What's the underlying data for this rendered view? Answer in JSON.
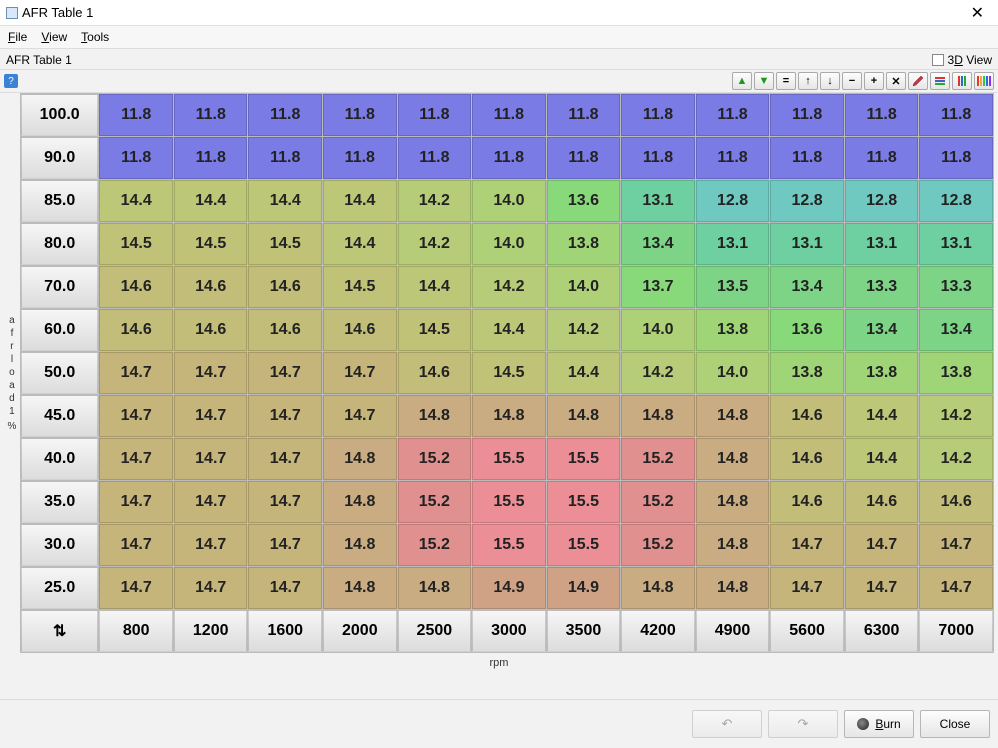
{
  "window": {
    "title": "AFR Table 1"
  },
  "menu": {
    "file": "File",
    "view": "View",
    "tools": "Tools"
  },
  "subheader": {
    "label": "AFR Table 1",
    "view3d": "3D View"
  },
  "toolbar_titles": {
    "up_green": "",
    "down_green": "",
    "eq": "=",
    "up": "↑",
    "down": "↓",
    "minus": "−",
    "plus": "+",
    "mul": "✕",
    "pencil": "",
    "hstripes": "",
    "vstripes": "",
    "colorbar": ""
  },
  "axis": {
    "y_chars": [
      "a",
      "f",
      "r",
      "l",
      "o",
      "a",
      "d",
      "1",
      "",
      "%"
    ],
    "x_label": "rpm"
  },
  "footer": {
    "burn": "Burn",
    "close": "Close"
  },
  "chart_data": {
    "type": "table",
    "title": "AFR Table 1",
    "xlabel": "rpm",
    "ylabel": "afrload1 %",
    "columns": [
      800,
      1200,
      1600,
      2000,
      2500,
      3000,
      3500,
      4200,
      4900,
      5600,
      6300,
      7000
    ],
    "row_headers": [
      100.0,
      90.0,
      85.0,
      80.0,
      70.0,
      60.0,
      50.0,
      45.0,
      40.0,
      35.0,
      30.0,
      25.0
    ],
    "rows": [
      [
        11.8,
        11.8,
        11.8,
        11.8,
        11.8,
        11.8,
        11.8,
        11.8,
        11.8,
        11.8,
        11.8,
        11.8
      ],
      [
        11.8,
        11.8,
        11.8,
        11.8,
        11.8,
        11.8,
        11.8,
        11.8,
        11.8,
        11.8,
        11.8,
        11.8
      ],
      [
        14.4,
        14.4,
        14.4,
        14.4,
        14.2,
        14.0,
        13.6,
        13.1,
        12.8,
        12.8,
        12.8,
        12.8
      ],
      [
        14.5,
        14.5,
        14.5,
        14.4,
        14.2,
        14.0,
        13.8,
        13.4,
        13.1,
        13.1,
        13.1,
        13.1
      ],
      [
        14.6,
        14.6,
        14.6,
        14.5,
        14.4,
        14.2,
        14.0,
        13.7,
        13.5,
        13.4,
        13.3,
        13.3
      ],
      [
        14.6,
        14.6,
        14.6,
        14.6,
        14.5,
        14.4,
        14.2,
        14.0,
        13.8,
        13.6,
        13.4,
        13.4
      ],
      [
        14.7,
        14.7,
        14.7,
        14.7,
        14.6,
        14.5,
        14.4,
        14.2,
        14.0,
        13.8,
        13.8,
        13.8
      ],
      [
        14.7,
        14.7,
        14.7,
        14.7,
        14.8,
        14.8,
        14.8,
        14.8,
        14.8,
        14.6,
        14.4,
        14.2
      ],
      [
        14.7,
        14.7,
        14.7,
        14.8,
        15.2,
        15.5,
        15.5,
        15.2,
        14.8,
        14.6,
        14.4,
        14.2
      ],
      [
        14.7,
        14.7,
        14.7,
        14.8,
        15.2,
        15.5,
        15.5,
        15.2,
        14.8,
        14.6,
        14.6,
        14.6
      ],
      [
        14.7,
        14.7,
        14.7,
        14.8,
        15.2,
        15.5,
        15.5,
        15.2,
        14.8,
        14.7,
        14.7,
        14.7
      ],
      [
        14.7,
        14.7,
        14.7,
        14.8,
        14.8,
        14.9,
        14.9,
        14.8,
        14.8,
        14.7,
        14.7,
        14.7
      ]
    ],
    "color_stops": [
      [
        11.8,
        "#7b7be6"
      ],
      [
        12.8,
        "#6fc9c0"
      ],
      [
        13.1,
        "#6ecfa1"
      ],
      [
        13.4,
        "#7dd487"
      ],
      [
        13.6,
        "#88d97a"
      ],
      [
        13.8,
        "#9fd577"
      ],
      [
        14.0,
        "#aed178"
      ],
      [
        14.2,
        "#b7cc78"
      ],
      [
        14.4,
        "#bcc778"
      ],
      [
        14.5,
        "#c0c277"
      ],
      [
        14.6,
        "#c2bd78"
      ],
      [
        14.7,
        "#c5b57b"
      ],
      [
        14.8,
        "#c9ac82"
      ],
      [
        14.9,
        "#cfa286"
      ],
      [
        15.2,
        "#e0908e"
      ],
      [
        15.5,
        "#ec8e96"
      ]
    ]
  }
}
